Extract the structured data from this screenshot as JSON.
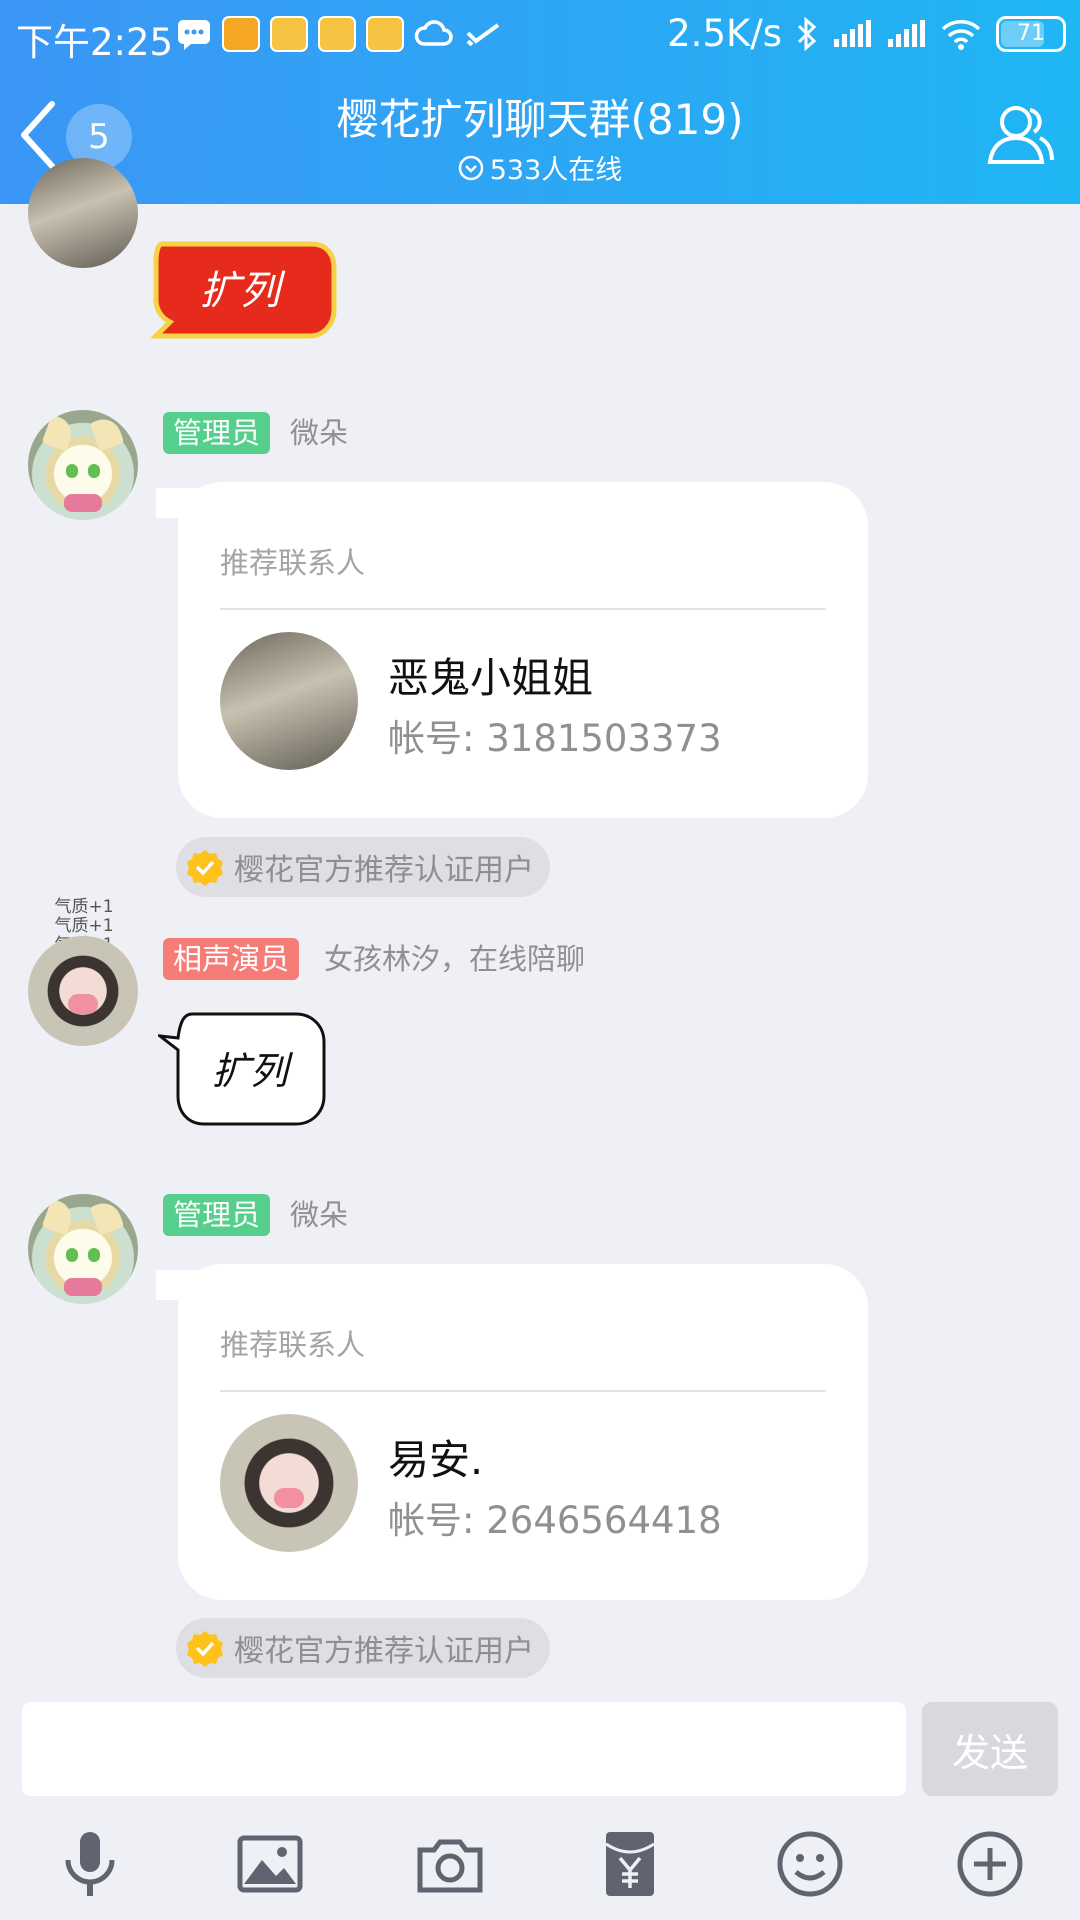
{
  "status_bar": {
    "time": "下午2:25",
    "network_speed": "2.5K/s",
    "battery_level": "71",
    "battery_percent": 71,
    "app_icons": [
      "message-icon",
      "taobao-icon",
      "store-icon",
      "store-icon",
      "store-icon",
      "cloud-icon",
      "check-icon"
    ],
    "app_icon_colors": [
      "#ffffff",
      "#f5a623",
      "#f6c343",
      "#f6c343",
      "#f6c343",
      "#ffffff",
      "#ffffff"
    ]
  },
  "header": {
    "unread_count": "5",
    "title": "樱花扩列聊天群(819)",
    "online": "533人在线"
  },
  "messages": [
    {
      "type": "sticker",
      "sticker_text": "扩列"
    },
    {
      "type": "card",
      "tag": "管理员",
      "nick": "微朵",
      "card_type": "推荐联系人",
      "name": "恶鬼小姐姐",
      "acct_label": "帐号:",
      "acct": "3181503373",
      "verified": "樱花官方推荐认证用户"
    },
    {
      "type": "text",
      "tag": "相声演员",
      "nick": "女孩林汐，在线陪聊",
      "text": "扩列",
      "aura": [
        "气质+1",
        "气质+1",
        "气质+1"
      ]
    },
    {
      "type": "card",
      "tag": "管理员",
      "nick": "微朵",
      "card_type": "推荐联系人",
      "name": "易安.",
      "acct_label": "帐号:",
      "acct": "2646564418",
      "verified": "樱花官方推荐认证用户"
    }
  ],
  "input": {
    "value": "",
    "placeholder": "",
    "send_label": "发送"
  },
  "toolbar": [
    "microphone-icon",
    "image-icon",
    "camera-icon",
    "red-packet-icon",
    "emoji-icon",
    "plus-icon"
  ],
  "colors": {
    "header_start": "#3b96f5",
    "header_end": "#1fb6f4",
    "admin_tag": "#56ce8c",
    "performer_tag": "#f57c77",
    "background": "#eff0f5",
    "verify_badge": "#ffc21a"
  }
}
